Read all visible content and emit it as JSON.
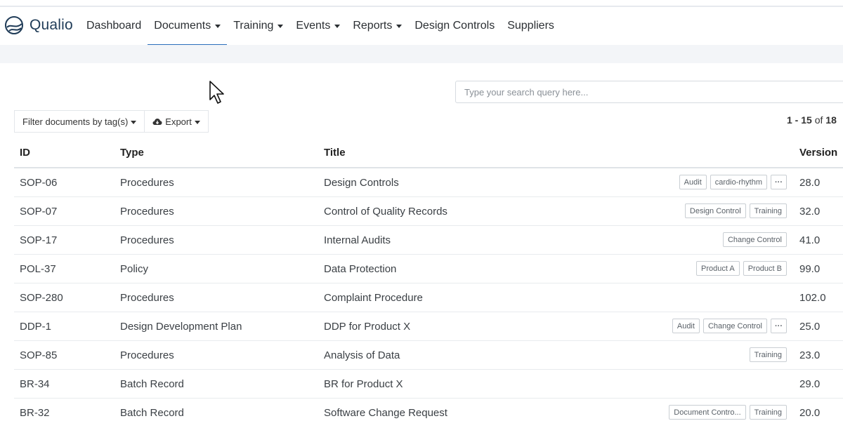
{
  "brand": {
    "name": "Qualio"
  },
  "nav": [
    {
      "label": "Dashboard",
      "caret": false,
      "active": false
    },
    {
      "label": "Documents",
      "caret": true,
      "active": true
    },
    {
      "label": "Training",
      "caret": true,
      "active": false
    },
    {
      "label": "Events",
      "caret": true,
      "active": false
    },
    {
      "label": "Reports",
      "caret": true,
      "active": false
    },
    {
      "label": "Design Controls",
      "caret": false,
      "active": false
    },
    {
      "label": "Suppliers",
      "caret": false,
      "active": false
    }
  ],
  "search": {
    "placeholder": "Type your search query here..."
  },
  "toolbar": {
    "filter_label": "Filter documents by tag(s)",
    "export_label": "Export"
  },
  "pager": {
    "range": "1 - 15",
    "of": "of",
    "total": "18"
  },
  "table": {
    "headers": {
      "id": "ID",
      "type": "Type",
      "title": "Title",
      "version": "Version"
    },
    "rows": [
      {
        "id": "SOP-06",
        "type": "Procedures",
        "title": "Design Controls",
        "version": "28.0",
        "tags": [
          "Audit",
          "cardio-rhythm",
          "···"
        ]
      },
      {
        "id": "SOP-07",
        "type": "Procedures",
        "title": "Control of Quality Records",
        "version": "32.0",
        "tags": [
          "Design Control",
          "Training"
        ]
      },
      {
        "id": "SOP-17",
        "type": "Procedures",
        "title": "Internal Audits",
        "version": "41.0",
        "tags": [
          "Change Control"
        ]
      },
      {
        "id": "POL-37",
        "type": "Policy",
        "title": "Data Protection",
        "version": "99.0",
        "tags": [
          "Product A",
          "Product B"
        ]
      },
      {
        "id": "SOP-280",
        "type": "Procedures",
        "title": "Complaint Procedure",
        "version": "102.0",
        "tags": []
      },
      {
        "id": "DDP-1",
        "type": "Design Development Plan",
        "title": "DDP for Product X",
        "version": "25.0",
        "tags": [
          "Audit",
          "Change Control",
          "···"
        ]
      },
      {
        "id": "SOP-85",
        "type": "Procedures",
        "title": "Analysis of Data",
        "version": "23.0",
        "tags": [
          "Training"
        ]
      },
      {
        "id": "BR-34",
        "type": "Batch Record",
        "title": "BR for Product X",
        "version": "29.0",
        "tags": []
      },
      {
        "id": "BR-32",
        "type": "Batch Record",
        "title": "Software Change Request",
        "version": "20.0",
        "tags": [
          "Document Contro...",
          "Training"
        ]
      }
    ]
  },
  "colors": {
    "accent": "#2a6ebb",
    "brand": "#1f3b57"
  }
}
